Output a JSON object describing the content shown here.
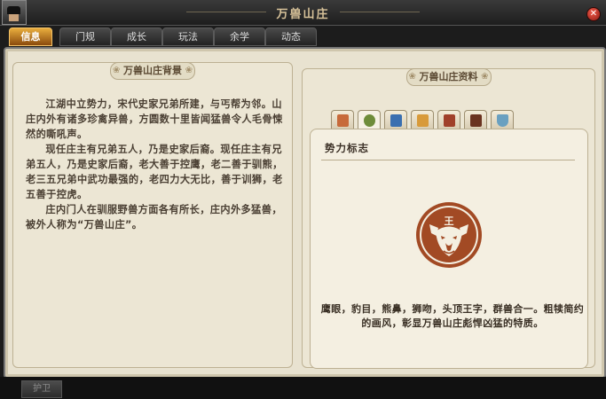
{
  "window": {
    "title": "万兽山庄"
  },
  "tabs": [
    {
      "label": "信息",
      "active": true
    },
    {
      "label": "门规",
      "active": false
    },
    {
      "label": "成长",
      "active": false
    },
    {
      "label": "玩法",
      "active": false
    },
    {
      "label": "余学",
      "active": false
    },
    {
      "label": "动态",
      "active": false
    }
  ],
  "background_panel": {
    "title": "万兽山庄背景",
    "paragraphs": [
      "江湖中立势力，宋代史家兄弟所建，与丐帮为邻。山庄内外有诸多珍禽异兽，方圆数十里皆闻猛兽令人毛骨悚然的嘶吼声。",
      "现任庄主有兄弟五人，乃是史家后裔。现任庄主有兄弟五人，乃是史家后裔，老大善于控鹰，老二善于驯熊，老三五兄弟中武功最强的，老四力大无比，善于训狮，老五善于控虎。",
      "庄内门人在驯服野兽方面各有所长，庄内外多猛兽，被外人称为“万兽山庄”。"
    ]
  },
  "info_panel": {
    "title": "万兽山庄资料",
    "icon_tabs": [
      "scroll-icon",
      "eye-icon",
      "book-icon",
      "map-icon",
      "banner-icon",
      "chest-icon",
      "boat-icon"
    ],
    "active_icon_tab": 1,
    "section_label": "势力标志",
    "emblem_text": "王",
    "description": "鹰眼，豹目，熊鼻，狮吻，头顶王字，群兽合一。粗犊简约的画风，彰显万兽山庄彪悍凶猛的特质。"
  },
  "bottom": {
    "button_label": "护卫"
  }
}
